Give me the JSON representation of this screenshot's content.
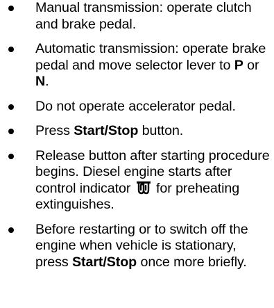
{
  "instructions": {
    "items": [
      {
        "parts": [
          {
            "text": "Manual transmission: operate clutch and brake pedal.",
            "bold": false
          }
        ]
      },
      {
        "parts": [
          {
            "text": "Automatic transmission: operate brake pedal and move selector lever to ",
            "bold": false
          },
          {
            "text": "P",
            "bold": true
          },
          {
            "text": " or ",
            "bold": false
          },
          {
            "text": "N",
            "bold": true
          },
          {
            "text": ".",
            "bold": false
          }
        ]
      },
      {
        "parts": [
          {
            "text": "Do not operate accelerator pedal.",
            "bold": false
          }
        ]
      },
      {
        "parts": [
          {
            "text": "Press ",
            "bold": false
          },
          {
            "text": "Start/Stop",
            "bold": true
          },
          {
            "text": " button.",
            "bold": false
          }
        ]
      },
      {
        "parts": [
          {
            "text": "Release button after starting procedure begins. Diesel engine starts after control indicator ",
            "bold": false
          },
          {
            "icon": "preheating-coil-icon"
          },
          {
            "text": " for preheating extinguishes.",
            "bold": false
          }
        ]
      },
      {
        "parts": [
          {
            "text": "Before restarting or to switch off the engine when vehicle is stationary, press ",
            "bold": false
          },
          {
            "text": "Start/Stop",
            "bold": true
          },
          {
            "text": " once more briefly.",
            "bold": false
          }
        ]
      }
    ]
  }
}
